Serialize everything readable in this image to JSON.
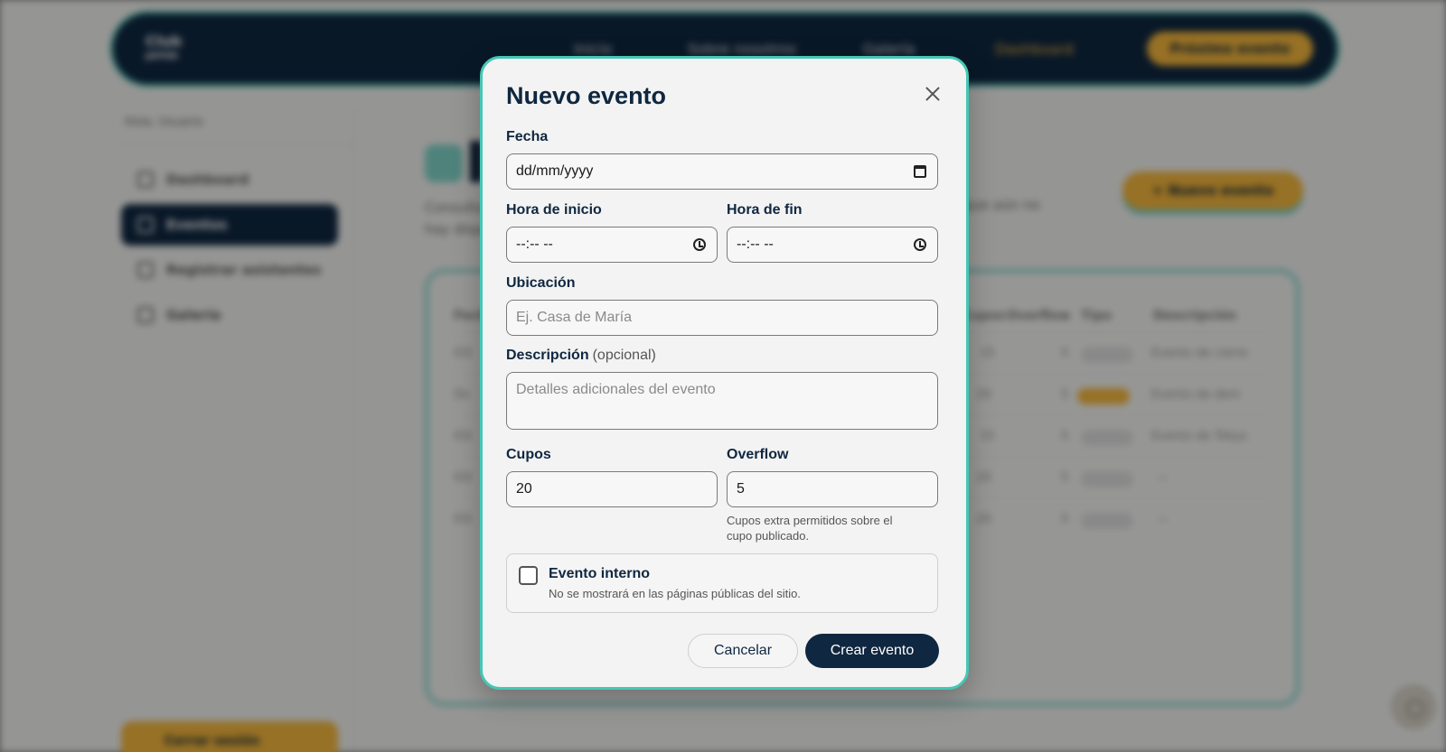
{
  "background": {
    "logo": {
      "line1": "Club",
      "line2": "JAPÓN"
    },
    "nav": [
      "Inicio",
      "Sobre nosotros",
      "Galería",
      "Dashboard"
    ],
    "nav_cta": "Próximo evento",
    "sidebar_user": "Hola, Usuario",
    "sidebar_items": [
      "Dashboard",
      "Eventos",
      "Registrar asistentes",
      "Galería"
    ],
    "sidebar_bottom": "Cerrar sesión",
    "main_desc_line1": "Consulta y administra los eventos",
    "main_desc_line2": "hay disponibles.",
    "main_desc_right": "que aún no",
    "new_event_button": "+ Nuevo evento",
    "table_headers": [
      "Fecha",
      "Cupos",
      "Overflow",
      "Tipo",
      "Descripción"
    ],
    "rows": [
      {
        "date": "03/",
        "cupos": "15",
        "overflow": "5",
        "tipo": "Público",
        "desc": "Evento de cierre",
        "hl": false
      },
      {
        "date": "Do",
        "cupos": "20",
        "overflow": "5",
        "tipo": "Interno",
        "desc": "Evento de dem",
        "hl": true
      },
      {
        "date": "03/",
        "cupos": "15",
        "overflow": "5",
        "tipo": "Público",
        "desc": "Evento de Tokyo",
        "hl": false
      },
      {
        "date": "03/",
        "cupos": "20",
        "overflow": "5",
        "tipo": "Público",
        "desc": "—",
        "hl": false
      },
      {
        "date": "03/",
        "cupos": "20",
        "overflow": "5",
        "tipo": "Público",
        "desc": "—",
        "hl": false
      }
    ]
  },
  "modal": {
    "title": "Nuevo evento",
    "fecha_label": "Fecha",
    "fecha_value": "dd/mm/yyyy",
    "hora_inicio_label": "Hora de inicio",
    "hora_inicio_value": "--:-- --",
    "hora_fin_label": "Hora de fin",
    "hora_fin_value": "--:-- --",
    "ubicacion_label": "Ubicación",
    "ubicacion_placeholder": "Ej. Casa de María",
    "descripcion_label": "Descripción",
    "descripcion_optional": "(opcional)",
    "descripcion_placeholder": "Detalles adicionales del evento",
    "cupos_label": "Cupos",
    "cupos_value": "20",
    "overflow_label": "Overflow",
    "overflow_value": "5",
    "overflow_hint_line1": "Cupos extra permitidos sobre el",
    "overflow_hint_line2": "cupo publicado.",
    "interno_title": "Evento interno",
    "interno_sub": "No se mostrará en las páginas públicas del sitio.",
    "cancel_label": "Cancelar",
    "create_label": "Crear evento"
  },
  "colors": {
    "navy": "#0f2740",
    "teal": "#45c7b4",
    "yellow": "#f4b63c"
  }
}
